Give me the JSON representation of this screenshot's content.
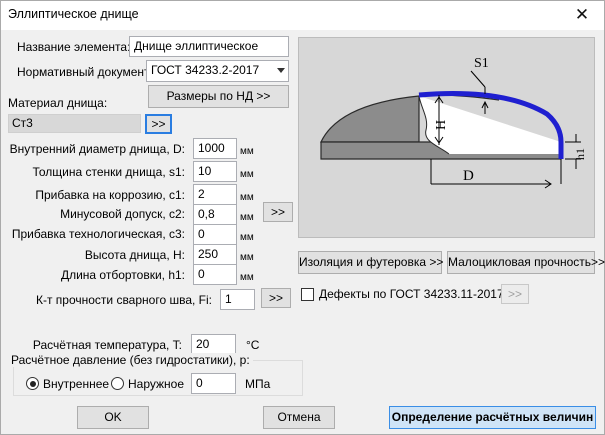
{
  "window": {
    "title": "Эллиптическое днище",
    "close_glyph": "✕"
  },
  "element": {
    "name_label": "Название элемента:",
    "name_value": "Днище эллиптическое"
  },
  "normative": {
    "label": "Нормативный документ:",
    "value": "ГОСТ 34233.2-2017"
  },
  "sizes_button": "Размеры по НД >>",
  "material": {
    "label": "Материал днища:",
    "value": "Ст3",
    "button": ">>"
  },
  "params": [
    {
      "label": "Внутренний диаметр днища, D:",
      "value": "1000",
      "unit": "мм"
    },
    {
      "label": "Толщина стенки днища, s1:",
      "value": "10",
      "unit": "мм"
    },
    {
      "label": "Прибавка на коррозию, c1:",
      "value": "2",
      "unit": "мм"
    },
    {
      "label": "Минусовой допуск, c2:",
      "value": "0,8",
      "unit": "мм"
    },
    {
      "label": "Прибавка технологическая, c3:",
      "value": "0",
      "unit": "мм"
    },
    {
      "label": "Высота днища, H:",
      "value": "250",
      "unit": "мм"
    },
    {
      "label": "Длина отбортовки, h1:",
      "value": "0",
      "unit": "мм"
    }
  ],
  "tolerance_button": ">>",
  "weld": {
    "label": "К-т прочности сварного шва, Fi:",
    "value": "1",
    "button": ">>"
  },
  "temperature": {
    "label": "Расчётная температура, T:",
    "value": "20",
    "unit": "°C"
  },
  "pressure": {
    "group_title": "Расчётное давление (без гидростатики), p:",
    "internal_label": "Внутреннее",
    "external_label": "Наружное",
    "value": "0",
    "unit": "МПа",
    "selected": "internal"
  },
  "diagram": {
    "s1_label": "S1",
    "h_label": "H",
    "h1_label": "h1",
    "d_label": "D"
  },
  "insulation_button": "Изоляция и футеровка >>",
  "cyclic_button": "Малоцикловая прочность>>",
  "defects": {
    "label": "Дефекты по ГОСТ 34233.11-2017",
    "button": ">>",
    "checked": false
  },
  "footer": {
    "ok": "OK",
    "cancel": "Отмена",
    "calc": "Определение расчётных величин"
  },
  "colors": {
    "highlight_blue": "#1f1fd0",
    "head_fill": "#8c8c8c",
    "panel_bg": "#d7d7d7"
  }
}
